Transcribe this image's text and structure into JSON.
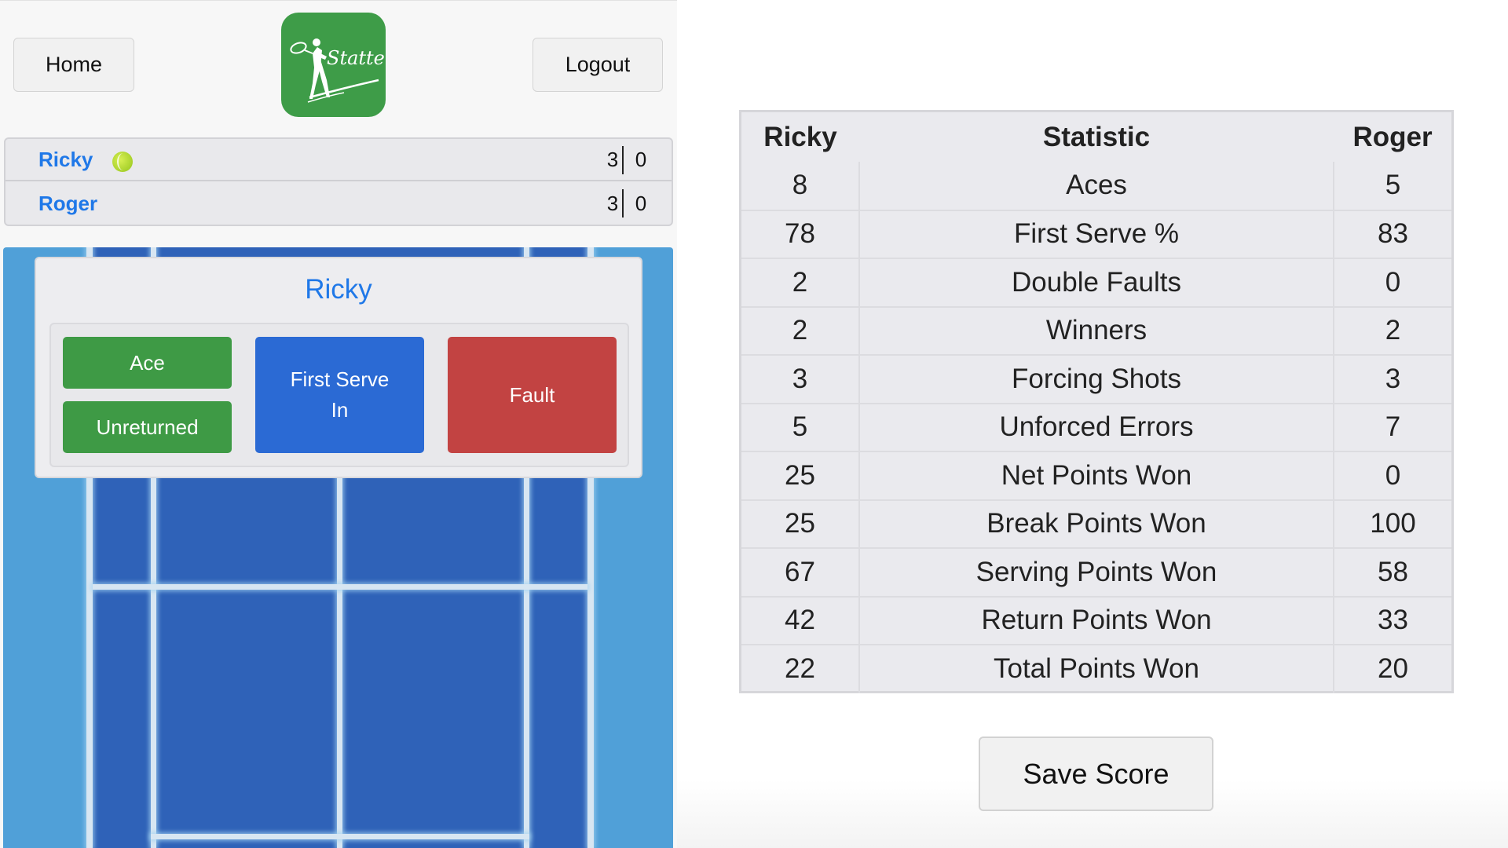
{
  "nav": {
    "home_label": "Home",
    "logout_label": "Logout",
    "logo_text": "Statter",
    "logo_color": "#3e9c48"
  },
  "scoreboard": {
    "players": [
      {
        "name": "Ricky",
        "sets": "3",
        "games": "0",
        "serving": true
      },
      {
        "name": "Roger",
        "sets": "3",
        "games": "0",
        "serving": false
      }
    ],
    "name_color": "#1f78e8"
  },
  "action_card": {
    "serving_player": "Ricky",
    "buttons": {
      "ace": "Ace",
      "unreturned": "Unreturned",
      "first_serve_in": "First Serve In",
      "fault": "Fault"
    },
    "colors": {
      "green": "#3e9a45",
      "blue": "#2b6ad4",
      "red": "#c24342"
    }
  },
  "stats": {
    "headers": {
      "left": "Ricky",
      "middle": "Statistic",
      "right": "Roger"
    },
    "rows": [
      {
        "left": "8",
        "stat": "Aces",
        "right": "5"
      },
      {
        "left": "78",
        "stat": "First Serve %",
        "right": "83"
      },
      {
        "left": "2",
        "stat": "Double Faults",
        "right": "0"
      },
      {
        "left": "2",
        "stat": "Winners",
        "right": "2"
      },
      {
        "left": "3",
        "stat": "Forcing Shots",
        "right": "3"
      },
      {
        "left": "5",
        "stat": "Unforced Errors",
        "right": "7"
      },
      {
        "left": "25",
        "stat": "Net Points Won",
        "right": "0"
      },
      {
        "left": "25",
        "stat": "Break Points Won",
        "right": "100"
      },
      {
        "left": "67",
        "stat": "Serving Points Won",
        "right": "58"
      },
      {
        "left": "42",
        "stat": "Return Points Won",
        "right": "33"
      },
      {
        "left": "22",
        "stat": "Total Points Won",
        "right": "20"
      }
    ]
  },
  "save_label": "Save Score"
}
